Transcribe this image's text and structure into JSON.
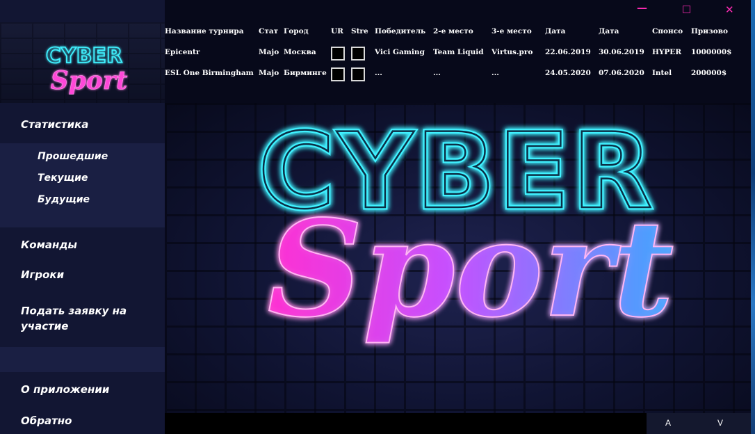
{
  "window": {
    "minimize_label": "—",
    "maximize_label": "□",
    "close_label": "✕"
  },
  "logo": {
    "cyber": "CYBER",
    "sport": "Sport"
  },
  "sidebar": {
    "statistics": "Статистика",
    "sub_items": [
      "Прошедшие",
      "Текущие",
      "Будущие"
    ],
    "teams": "Команды",
    "players": "Игроки",
    "apply_line1": "Подать заявку на",
    "apply_line2": "участие",
    "about": "О приложении",
    "feedback": "Обратно"
  },
  "table": {
    "headers": [
      "Название турнира",
      "Стат",
      "Город",
      "UR",
      "Stre",
      "Победитель",
      "2-е место",
      "3-е место",
      "Дата",
      "Дата",
      "Спонсо",
      "Призово"
    ],
    "rows": [
      {
        "name": "Epicentr",
        "status": "Majo",
        "city": "Москва",
        "winner": "Vici Gaming",
        "second": "Team Liquid",
        "third": "Virtus.pro",
        "date_start": "22.06.2019",
        "date_end": "30.06.2019",
        "sponsor": "HYPER",
        "prize": "1000000$"
      },
      {
        "name": "ESL One Birmingham",
        "status": "Majo",
        "city": "Бирминге",
        "winner": "...",
        "second": "...",
        "third": "...",
        "date_start": "24.05.2020",
        "date_end": "07.06.2020",
        "sponsor": "Intel",
        "prize": "200000$"
      }
    ]
  },
  "footer": {
    "a_label": "A",
    "v_label": "V"
  },
  "colors": {
    "neon_cyan": "#3ff1ff",
    "neon_pink": "#ff3fd0",
    "neon_blue": "#39a6ff",
    "close_pink": "#ff2bb5"
  }
}
